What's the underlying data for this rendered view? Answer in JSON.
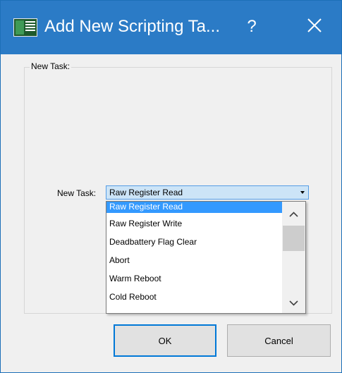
{
  "window": {
    "title": "Add New Scripting Ta...",
    "help_label": "?",
    "close_icon": "close-icon",
    "app_icon": "window-app-icon",
    "titlebar_color": "#2b7bc6"
  },
  "group": {
    "legend": "New Task:"
  },
  "task_field": {
    "label": "New Task:",
    "selected_value": "Raw Register Read",
    "options": [
      "Raw Register Read",
      "Raw Register Write",
      "Deadbattery Flag Clear",
      "Abort",
      "Warm Reboot",
      "Cold Reboot"
    ],
    "highlight_color": "#3399ff"
  },
  "buttons": {
    "ok": "OK",
    "cancel": "Cancel"
  }
}
